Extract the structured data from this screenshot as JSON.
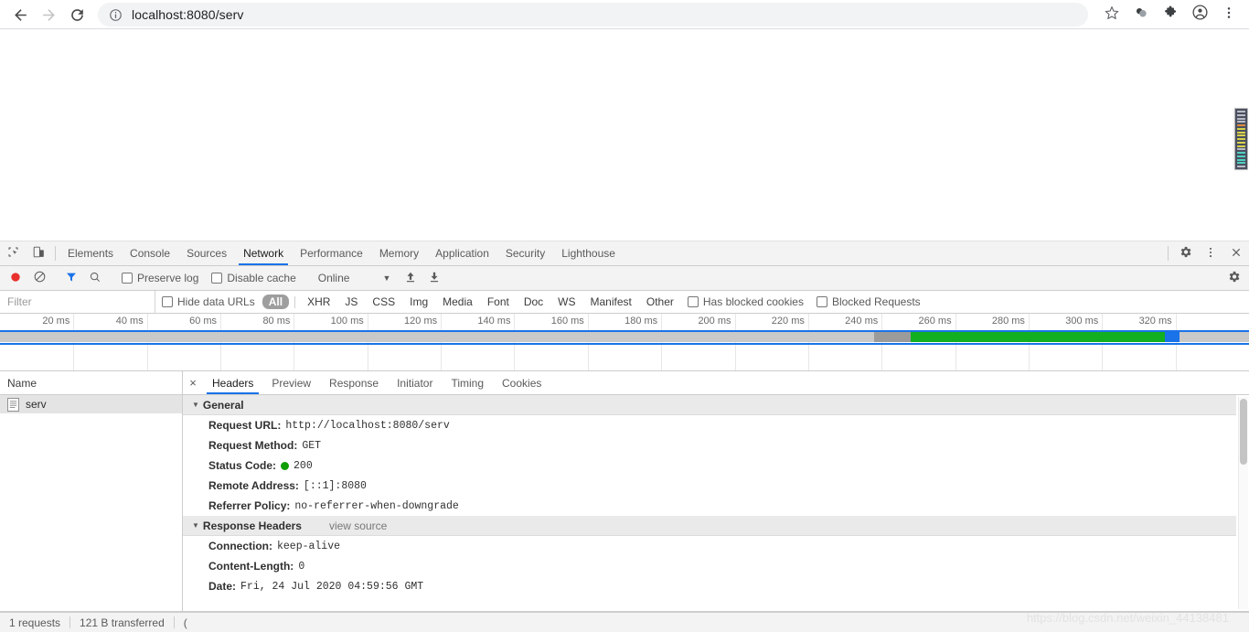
{
  "browser": {
    "back_icon": "back-arrow-icon",
    "forward_icon": "forward-arrow-icon",
    "reload_icon": "reload-icon",
    "info_icon": "site-info-icon",
    "url": "localhost:8080/serv",
    "star_icon": "bookmark-star-icon",
    "extension_icons": [
      "colorpick-extension-icon",
      "puzzle-extensions-icon"
    ],
    "profile_icon": "profile-avatar-icon",
    "menu_icon": "three-dot-menu-icon"
  },
  "devtools": {
    "inspect_icon": "inspect-element-icon",
    "device_toolbar_icon": "device-toolbar-icon",
    "tabs": [
      {
        "label": "Elements",
        "active": false
      },
      {
        "label": "Console",
        "active": false
      },
      {
        "label": "Sources",
        "active": false
      },
      {
        "label": "Network",
        "active": true
      },
      {
        "label": "Performance",
        "active": false
      },
      {
        "label": "Memory",
        "active": false
      },
      {
        "label": "Application",
        "active": false
      },
      {
        "label": "Security",
        "active": false
      },
      {
        "label": "Lighthouse",
        "active": false
      }
    ],
    "settings_icon": "gear-settings-icon",
    "more_icon": "three-dot-more-icon",
    "close_icon": "close-devtools-icon"
  },
  "network_toolbar": {
    "record_icon": "record-stop-icon",
    "clear_icon": "clear-network-log-icon",
    "filter_icon": "filter-funnel-icon",
    "search_icon": "search-magnifier-icon",
    "preserve_log_label": "Preserve log",
    "preserve_log_checked": false,
    "disable_cache_label": "Disable cache",
    "disable_cache_checked": false,
    "throttle_value": "Online",
    "throttle_caret_icon": "chevron-down-icon",
    "import_icon": "import-har-icon",
    "export_icon": "export-har-icon",
    "right_settings_icon": "network-settings-gear-icon"
  },
  "filter_bar": {
    "filter_placeholder": "Filter",
    "hide_data_urls_label": "Hide data URLs",
    "hide_data_urls_checked": false,
    "types": [
      {
        "label": "All",
        "selected": true
      },
      {
        "label": "XHR",
        "selected": false
      },
      {
        "label": "JS",
        "selected": false
      },
      {
        "label": "CSS",
        "selected": false
      },
      {
        "label": "Img",
        "selected": false
      },
      {
        "label": "Media",
        "selected": false
      },
      {
        "label": "Font",
        "selected": false
      },
      {
        "label": "Doc",
        "selected": false
      },
      {
        "label": "WS",
        "selected": false
      },
      {
        "label": "Manifest",
        "selected": false
      },
      {
        "label": "Other",
        "selected": false
      }
    ],
    "has_blocked_cookies_label": "Has blocked cookies",
    "has_blocked_cookies_checked": false,
    "blocked_requests_label": "Blocked Requests",
    "blocked_requests_checked": false
  },
  "chart_data": {
    "type": "area",
    "title": "Network overview timeline",
    "xlabel": "",
    "ylabel": "",
    "tick_labels": [
      "20 ms",
      "40 ms",
      "60 ms",
      "80 ms",
      "100 ms",
      "120 ms",
      "140 ms",
      "160 ms",
      "180 ms",
      "200 ms",
      "220 ms",
      "240 ms",
      "260 ms",
      "280 ms",
      "300 ms",
      "320 ms"
    ],
    "tick_values": [
      20,
      40,
      60,
      80,
      100,
      120,
      140,
      160,
      180,
      200,
      220,
      240,
      260,
      280,
      300,
      320
    ],
    "xlim": [
      0,
      340
    ],
    "grid": true,
    "series": [
      {
        "name": "serv",
        "segments": [
          {
            "phase": "stalled/queueing",
            "start_ms": 0,
            "end_ms": 238,
            "color": "#c9c9c9"
          },
          {
            "phase": "waiting-ttfb",
            "start_ms": 238,
            "end_ms": 248,
            "color": "#9b9b9b"
          },
          {
            "phase": "content-download",
            "start_ms": 248,
            "end_ms": 317,
            "color": "#12b020"
          },
          {
            "phase": "end-marker",
            "start_ms": 317,
            "end_ms": 321,
            "color": "#1a73e8"
          }
        ]
      }
    ]
  },
  "request_list": {
    "column_header": "Name",
    "rows": [
      {
        "name": "serv",
        "icon": "document-file-icon",
        "selected": true
      }
    ]
  },
  "detail_pane": {
    "close_label": "×",
    "tabs": [
      {
        "label": "Headers",
        "active": true
      },
      {
        "label": "Preview",
        "active": false
      },
      {
        "label": "Response",
        "active": false
      },
      {
        "label": "Initiator",
        "active": false
      },
      {
        "label": "Timing",
        "active": false
      },
      {
        "label": "Cookies",
        "active": false
      }
    ],
    "sections": [
      {
        "title": "General",
        "view_source": "",
        "rows": [
          {
            "key": "Request URL:",
            "value": "http://localhost:8080/serv",
            "status_dot": false
          },
          {
            "key": "Request Method:",
            "value": "GET",
            "status_dot": false
          },
          {
            "key": "Status Code:",
            "value": "200",
            "status_dot": true,
            "dot_color": "#0f9d00"
          },
          {
            "key": "Remote Address:",
            "value": "[::1]:8080",
            "status_dot": false
          },
          {
            "key": "Referrer Policy:",
            "value": "no-referrer-when-downgrade",
            "status_dot": false
          }
        ]
      },
      {
        "title": "Response Headers",
        "view_source": "view source",
        "rows": [
          {
            "key": "Connection:",
            "value": "keep-alive",
            "status_dot": false
          },
          {
            "key": "Content-Length:",
            "value": "0",
            "status_dot": false
          },
          {
            "key": "Date:",
            "value": "Fri, 24 Jul 2020 04:59:56 GMT",
            "status_dot": false
          }
        ]
      }
    ]
  },
  "status_bar": {
    "requests": "1 requests",
    "transferred": "121 B transferred",
    "extra": "("
  },
  "watermark": "https://blog.csdn.net/weixin_44138481",
  "colors": {
    "accent": "#1a73e8",
    "download_green": "#12b020",
    "status_green": "#0f9d00",
    "selected_filter_bg": "#9e9e9e"
  },
  "minimap_lines": [
    "#b9bcc6",
    "#b9bcc6",
    "#b9bcc6",
    "#b9bcc6",
    "#e08a3c",
    "#d9d34a",
    "#d9d34a",
    "#d9d34a",
    "#d9d34a",
    "#d9d34a",
    "#d9d34a",
    "#b9bcc6",
    "#4fd0c0",
    "#4fd0c0",
    "#4fd0c0",
    "#4fd0c0",
    "#b9bcc6"
  ]
}
